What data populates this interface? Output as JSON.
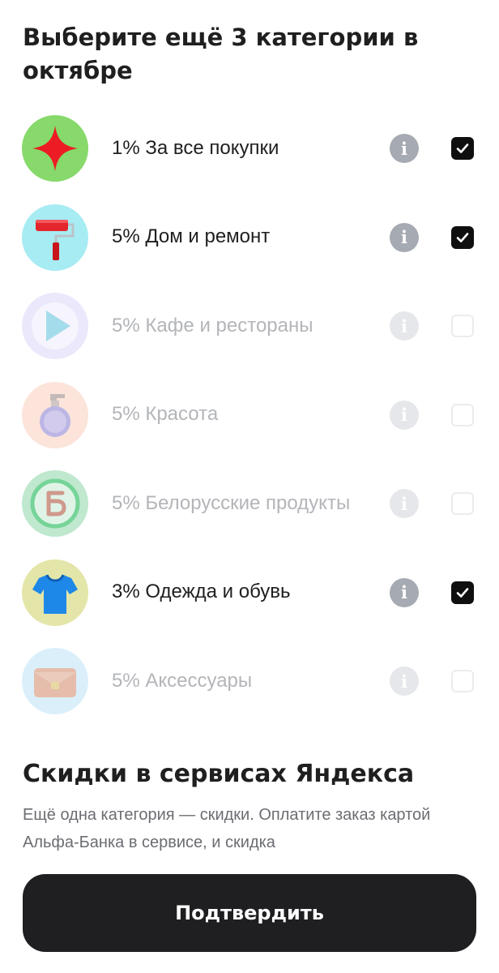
{
  "header": {
    "title": "Выберите ещё 3 категории в октябре"
  },
  "colors": {
    "selected_text": "#1f1f1f",
    "disabled_text": "#b3b5b9",
    "checkbox_checked": "#0f0f0f",
    "button_bg": "#1f1f21"
  },
  "categories": [
    {
      "label": "1% За все покупки",
      "checked": true,
      "enabled": true,
      "icon": "red-star-icon",
      "icon_bg": "#86d96a"
    },
    {
      "label": "5% Дом и ремонт",
      "checked": true,
      "enabled": true,
      "icon": "paint-roller-icon",
      "icon_bg": "#a7ecf3"
    },
    {
      "label": "5% Кафе и рестораны",
      "checked": false,
      "enabled": false,
      "icon": "play-triangle-icon",
      "icon_bg": "#e8e4fb"
    },
    {
      "label": "5% Красота",
      "checked": false,
      "enabled": false,
      "icon": "perfume-bottle-icon",
      "icon_bg": "#fbe1d6"
    },
    {
      "label": "5% Белорусские продукты",
      "checked": false,
      "enabled": false,
      "icon": "cyrillic-b-icon",
      "icon_bg": "#bfe8cf"
    },
    {
      "label": "3% Одежда и обувь",
      "checked": true,
      "enabled": true,
      "icon": "tshirt-icon",
      "icon_bg": "#e3e6a8"
    },
    {
      "label": "5% Аксессуары",
      "checked": false,
      "enabled": false,
      "icon": "clutch-bag-icon",
      "icon_bg": "#dbeffb"
    }
  ],
  "info_glyph": "i",
  "yandex": {
    "title": "Скидки в сервисах Яндекса",
    "description": "Ещё одна категория — скидки. Оплатите заказ картой Альфа-Банка в сервисе, и скидка"
  },
  "confirm_label": "Подтвердить"
}
